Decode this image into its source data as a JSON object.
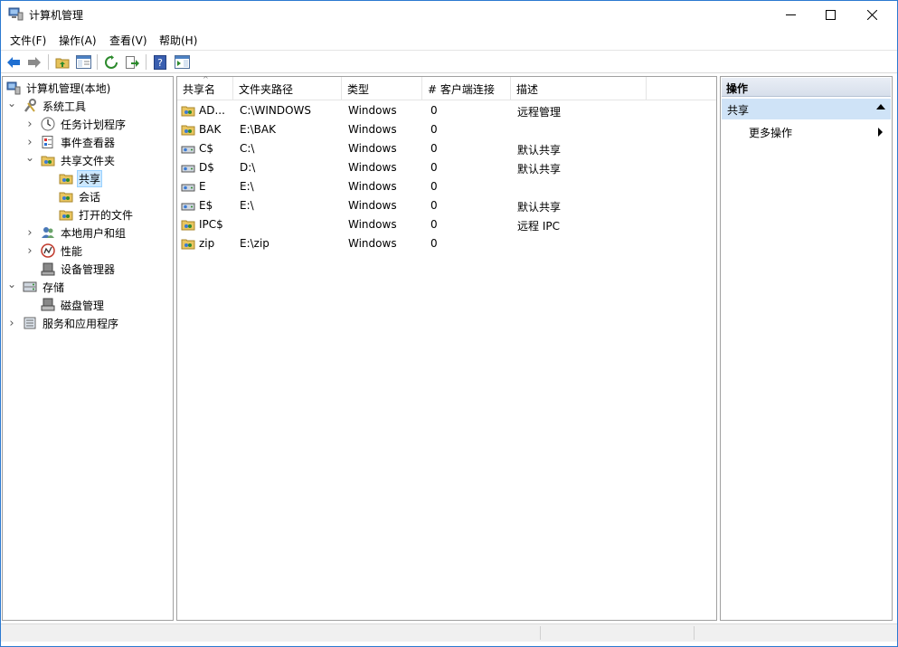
{
  "window": {
    "title": "计算机管理",
    "colors": {
      "accent_border": "#2b79d0",
      "selection_bg": "#cce8ff",
      "action_section_bg": "#cfe3f7"
    }
  },
  "menu": {
    "items": [
      {
        "label": "文件(F)"
      },
      {
        "label": "操作(A)"
      },
      {
        "label": "查看(V)"
      },
      {
        "label": "帮助(H)"
      }
    ]
  },
  "toolbar": {
    "buttons": [
      {
        "icon": "back-arrow-icon"
      },
      {
        "icon": "forward-arrow-icon"
      },
      {
        "icon": "up-folder-icon"
      },
      {
        "icon": "show-hide-console-tree-icon"
      },
      {
        "icon": "refresh-icon"
      },
      {
        "icon": "export-list-icon"
      },
      {
        "icon": "help-icon"
      },
      {
        "icon": "show-hide-action-pane-icon"
      }
    ]
  },
  "tree": {
    "items": [
      {
        "label": "计算机管理(本地)",
        "icon": "computer-management-icon",
        "toggle": ""
      },
      {
        "label": "系统工具",
        "icon": "tools-icon",
        "toggle": "expanded"
      },
      {
        "label": "任务计划程序",
        "icon": "clock-icon",
        "toggle": "collapsed"
      },
      {
        "label": "事件查看器",
        "icon": "event-viewer-icon",
        "toggle": "collapsed"
      },
      {
        "label": "共享文件夹",
        "icon": "shared-folder-icon",
        "toggle": "expanded"
      },
      {
        "label": "共享",
        "icon": "shared-folder-icon",
        "toggle": "",
        "selected": true
      },
      {
        "label": "会话",
        "icon": "shared-folder-icon",
        "toggle": ""
      },
      {
        "label": "打开的文件",
        "icon": "shared-folder-icon",
        "toggle": ""
      },
      {
        "label": "本地用户和组",
        "icon": "users-icon",
        "toggle": "collapsed"
      },
      {
        "label": "性能",
        "icon": "performance-icon",
        "toggle": "collapsed"
      },
      {
        "label": "设备管理器",
        "icon": "device-manager-icon",
        "toggle": ""
      },
      {
        "label": "存储",
        "icon": "storage-icon",
        "toggle": "expanded"
      },
      {
        "label": "磁盘管理",
        "icon": "disk-management-icon",
        "toggle": ""
      },
      {
        "label": "服务和应用程序",
        "icon": "services-icon",
        "toggle": "collapsed"
      }
    ]
  },
  "list": {
    "columns": [
      "共享名",
      "文件夹路径",
      "类型",
      "# 客户端连接",
      "描述"
    ],
    "rows": [
      {
        "name": "AD...",
        "path": "C:\\WINDOWS",
        "type": "Windows",
        "clients": "0",
        "desc": "远程管理",
        "icon": "share-folder-icon"
      },
      {
        "name": "BAK",
        "path": "E:\\BAK",
        "type": "Windows",
        "clients": "0",
        "desc": "",
        "icon": "share-folder-icon"
      },
      {
        "name": "C$",
        "path": "C:\\",
        "type": "Windows",
        "clients": "0",
        "desc": "默认共享",
        "icon": "share-drive-icon"
      },
      {
        "name": "D$",
        "path": "D:\\",
        "type": "Windows",
        "clients": "0",
        "desc": "默认共享",
        "icon": "share-drive-icon"
      },
      {
        "name": "E",
        "path": "E:\\",
        "type": "Windows",
        "clients": "0",
        "desc": "",
        "icon": "share-drive-icon"
      },
      {
        "name": "E$",
        "path": "E:\\",
        "type": "Windows",
        "clients": "0",
        "desc": "默认共享",
        "icon": "share-drive-icon"
      },
      {
        "name": "IPC$",
        "path": "",
        "type": "Windows",
        "clients": "0",
        "desc": "远程 IPC",
        "icon": "share-folder-icon"
      },
      {
        "name": "zip",
        "path": "E:\\zip",
        "type": "Windows",
        "clients": "0",
        "desc": "",
        "icon": "share-folder-icon"
      }
    ]
  },
  "actions": {
    "header": "操作",
    "section": "共享",
    "items": [
      {
        "label": "更多操作"
      }
    ]
  }
}
